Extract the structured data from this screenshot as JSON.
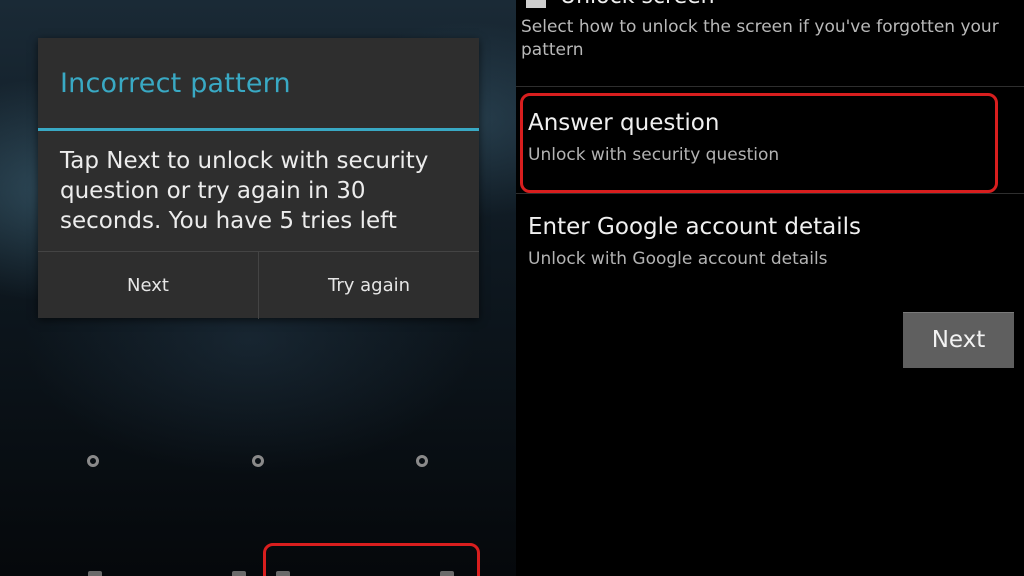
{
  "lock_screen": {
    "dialog": {
      "title": "Incorrect pattern",
      "message": "Tap Next to unlock with security question or try again in 30 seconds. You have 5 tries left",
      "buttons": {
        "next": "Next",
        "try_again": "Try again"
      }
    },
    "pattern_dots_visible": 3
  },
  "unlock_options": {
    "top_option": {
      "label": "Unlock screen",
      "description": "Select how to unlock the screen if you've forgotten your pattern"
    },
    "options": [
      {
        "title": "Answer question",
        "description": "Unlock with security question",
        "highlighted": true
      },
      {
        "title": "Enter Google account details",
        "description": "Unlock with Google account details",
        "highlighted": false
      }
    ],
    "next_button": "Next"
  },
  "colors": {
    "accent": "#39a9c4",
    "highlight": "#d81e1e",
    "dialog_bg": "#2e2e2e",
    "panel_bg": "#000000",
    "button_bg": "#5f5f5f"
  }
}
